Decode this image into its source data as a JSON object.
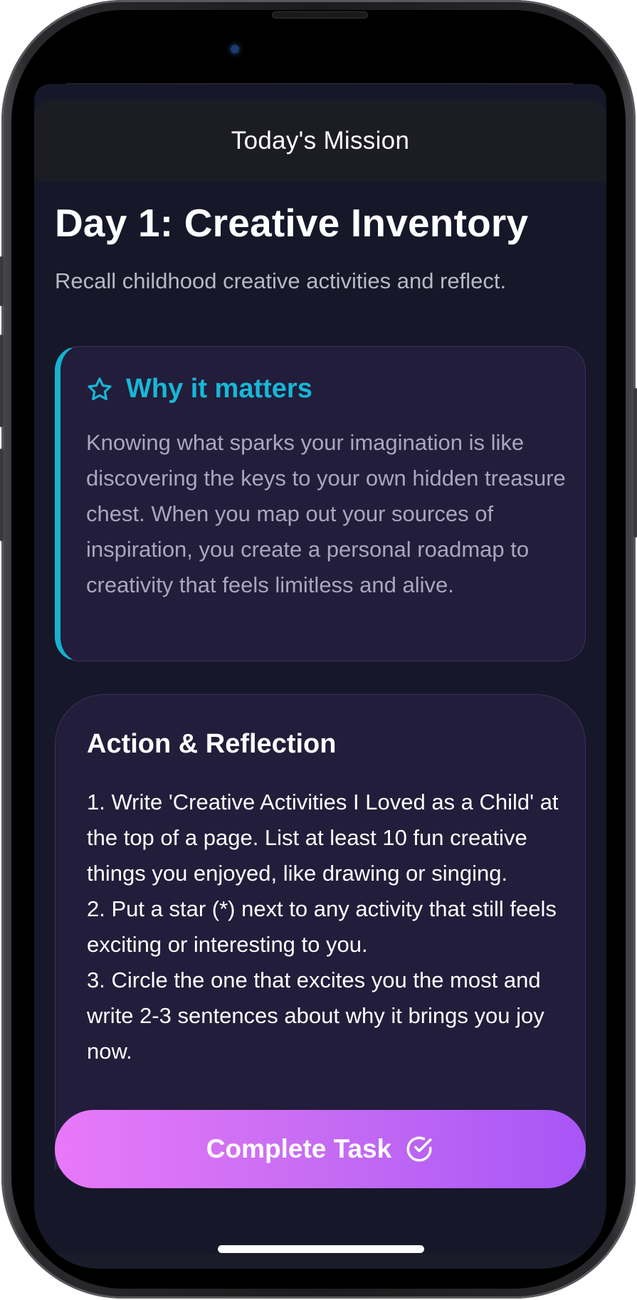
{
  "header": {
    "title": "Today's Mission"
  },
  "mission": {
    "title": "Day 1: Creative Inventory",
    "subtitle": "Recall childhood creative activities and reflect."
  },
  "why_card": {
    "icon": "star-icon",
    "title": "Why it matters",
    "body": "Knowing what sparks your imagination is like discovering the keys to your own hidden treasure chest. When you map out your sources of inspiration, you create a personal roadmap to creativity that feels limitless and alive."
  },
  "action_card": {
    "title": "Action & Reflection",
    "steps": [
      "1. Write 'Creative Activities I Loved as a Child' at the top of a page. List at least 10 fun creative things you enjoyed, like drawing or singing.",
      "2. Put a star (*) next to any activity that still feels exciting or interesting to you.",
      "3. Circle the one that excites you the most and write 2-3 sentences about why it brings you joy now."
    ]
  },
  "complete_button": {
    "label": "Complete Task",
    "icon": "check-circle-icon"
  },
  "colors": {
    "background": "#161728",
    "card": "#221d3a",
    "accent_cyan": "#16b2cf",
    "button_gradient_start": "#e879f9",
    "button_gradient_end": "#a855f7"
  }
}
